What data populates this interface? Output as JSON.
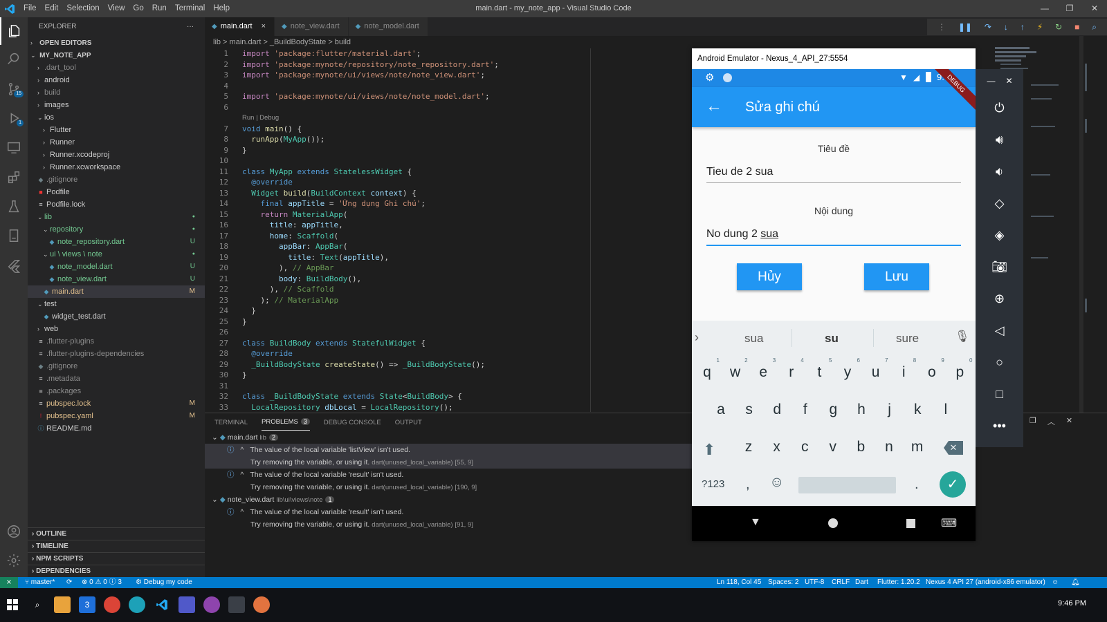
{
  "titlebar": {
    "menu": [
      "File",
      "Edit",
      "Selection",
      "View",
      "Go",
      "Run",
      "Terminal",
      "Help"
    ],
    "window_title": "main.dart - my_note_app - Visual Studio Code"
  },
  "activity": {
    "scm_badge": "15",
    "debug_badge": "1"
  },
  "sidebar": {
    "title": "EXPLORER",
    "more": "···",
    "open_editors": "OPEN EDITORS",
    "project": "MY_NOTE_APP",
    "tree": [
      {
        "label": ".dart_tool",
        "status": ""
      },
      {
        "label": "android",
        "status": ""
      },
      {
        "label": "build",
        "status": ""
      },
      {
        "label": "images",
        "status": ""
      },
      {
        "label": "ios",
        "status": ""
      },
      {
        "label": "Flutter",
        "status": ""
      },
      {
        "label": "Runner",
        "status": ""
      },
      {
        "label": "Runner.xcodeproj",
        "status": ""
      },
      {
        "label": "Runner.xcworkspace",
        "status": ""
      },
      {
        "label": ".gitignore",
        "status": ""
      },
      {
        "label": "Podfile",
        "status": ""
      },
      {
        "label": "Podfile.lock",
        "status": ""
      },
      {
        "label": "lib",
        "status": "●"
      },
      {
        "label": "repository",
        "status": "●"
      },
      {
        "label": "note_repository.dart",
        "status": "U"
      },
      {
        "label": "ui \\ views \\ note",
        "status": "●"
      },
      {
        "label": "note_model.dart",
        "status": "U"
      },
      {
        "label": "note_view.dart",
        "status": "U"
      },
      {
        "label": "main.dart",
        "status": "M"
      },
      {
        "label": "test",
        "status": ""
      },
      {
        "label": "widget_test.dart",
        "status": ""
      },
      {
        "label": "web",
        "status": ""
      },
      {
        "label": ".flutter-plugins",
        "status": ""
      },
      {
        "label": ".flutter-plugins-dependencies",
        "status": ""
      },
      {
        "label": ".gitignore",
        "status": ""
      },
      {
        "label": ".metadata",
        "status": ""
      },
      {
        "label": ".packages",
        "status": ""
      },
      {
        "label": "pubspec.lock",
        "status": "M"
      },
      {
        "label": "pubspec.yaml",
        "status": "M"
      },
      {
        "label": "README.md",
        "status": ""
      }
    ],
    "sections": [
      "OUTLINE",
      "TIMELINE",
      "NPM SCRIPTS",
      "DEPENDENCIES"
    ]
  },
  "tabs": [
    {
      "label": "main.dart",
      "close": "×"
    },
    {
      "label": "note_view.dart"
    },
    {
      "label": "note_model.dart"
    }
  ],
  "breadcrumb": "lib  >  main.dart  >  _BuildBodyState  >  build",
  "code": {
    "codelens": "Run | Debug",
    "lines": [
      {
        "n": "1",
        "html": "<span class=\"kw2\">import</span> <span class=\"st2\">'package:flutter/material.dart'</span>;"
      },
      {
        "n": "2",
        "html": "<span class=\"kw2\">import</span> <span class=\"st2\">'package:mynote/repository/note_repository.dart'</span>;"
      },
      {
        "n": "3",
        "html": "<span class=\"kw2\">import</span> <span class=\"st2\">'package:mynote/ui/views/note/note_view.dart'</span>;"
      },
      {
        "n": "4",
        "html": ""
      },
      {
        "n": "5",
        "html": "<span class=\"kw2\">import</span> <span class=\"st2\">'package:mynote/ui/views/note/note_model.dart'</span>;"
      },
      {
        "n": "6",
        "html": ""
      },
      {
        "n": "7",
        "html": "<span class=\"kw\">void</span> <span class=\"fn\">main</span>() {"
      },
      {
        "n": "8",
        "html": "  <span class=\"fn\">runApp</span>(<span class=\"ty\">MyApp</span>());"
      },
      {
        "n": "9",
        "html": "}"
      },
      {
        "n": "10",
        "html": ""
      },
      {
        "n": "11",
        "html": "<span class=\"kw\">class</span> <span class=\"ty\">MyApp</span> <span class=\"kw\">extends</span> <span class=\"ty\">StatelessWidget</span> {"
      },
      {
        "n": "12",
        "html": "  <span class=\"kw\">@override</span>"
      },
      {
        "n": "13",
        "html": "  <span class=\"ty\">Widget</span> <span class=\"fn\">build</span>(<span class=\"ty\">BuildContext</span> <span class=\"pr\">context</span>) {"
      },
      {
        "n": "14",
        "html": "    <span class=\"kw\">final</span> <span class=\"pr\">appTitle</span> = <span class=\"st2\">'Ứng dụng Ghi chú'</span>;"
      },
      {
        "n": "15",
        "html": "    <span class=\"kw2\">return</span> <span class=\"ty\">MaterialApp</span>("
      },
      {
        "n": "16",
        "html": "      <span class=\"pr\">title</span>: <span class=\"pr\">appTitle</span>,"
      },
      {
        "n": "17",
        "html": "      <span class=\"pr\">home</span>: <span class=\"ty\">Scaffold</span>("
      },
      {
        "n": "18",
        "html": "        <span class=\"pr\">appBar</span>: <span class=\"ty\">AppBar</span>("
      },
      {
        "n": "19",
        "html": "          <span class=\"pr\">title</span>: <span class=\"ty\">Text</span>(<span class=\"pr\">appTitle</span>),"
      },
      {
        "n": "20",
        "html": "        ), <span class=\"cm\">// AppBar</span>"
      },
      {
        "n": "21",
        "html": "        <span class=\"pr\">body</span>: <span class=\"ty\">BuildBody</span>(),"
      },
      {
        "n": "22",
        "html": "      ), <span class=\"cm\">// Scaffold</span>"
      },
      {
        "n": "23",
        "html": "    ); <span class=\"cm\">// MaterialApp</span>"
      },
      {
        "n": "24",
        "html": "  }"
      },
      {
        "n": "25",
        "html": "}"
      },
      {
        "n": "26",
        "html": ""
      },
      {
        "n": "27",
        "html": "<span class=\"kw\">class</span> <span class=\"ty\">BuildBody</span> <span class=\"kw\">extends</span> <span class=\"ty\">StatefulWidget</span> {"
      },
      {
        "n": "28",
        "html": "  <span class=\"kw\">@override</span>"
      },
      {
        "n": "29",
        "html": "  <span class=\"ty\">_BuildBodyState</span> <span class=\"fn\">createState</span>() =&gt; <span class=\"ty\">_BuildBodyState</span>();"
      },
      {
        "n": "30",
        "html": "}"
      },
      {
        "n": "31",
        "html": ""
      },
      {
        "n": "32",
        "html": "<span class=\"kw\">class</span> <span class=\"ty\">_BuildBodyState</span> <span class=\"kw\">extends</span> <span class=\"ty\">State</span>&lt;<span class=\"ty\">BuildBody</span>&gt; {"
      },
      {
        "n": "33",
        "html": "  <span class=\"ty\">LocalRepository</span> <span class=\"pr\">dbLocal</span> = <span class=\"ty\">LocalRepository</span>();"
      }
    ]
  },
  "panel": {
    "tabs": [
      "TERMINAL",
      "PROBLEMS",
      "DEBUG CONSOLE",
      "OUTPUT"
    ],
    "problems_count": "3",
    "groups": [
      {
        "file": "main.dart",
        "path": "lib",
        "count": "2",
        "items": [
          {
            "msg": "The value of the local variable 'listView' isn't used.",
            "hint": "Try removing the variable, or using it.",
            "src": "dart(unused_local_variable)",
            "pos": "[55, 9]"
          },
          {
            "msg": "The value of the local variable 'result' isn't used.",
            "hint": "Try removing the variable, or using it.",
            "src": "dart(unused_local_variable)",
            "pos": "[190, 9]"
          }
        ]
      },
      {
        "file": "note_view.dart",
        "path": "lib\\ui\\views\\note",
        "count": "1",
        "items": [
          {
            "msg": "The value of the local variable 'result' isn't used.",
            "hint": "Try removing the variable, or using it.",
            "src": "dart(unused_local_variable)",
            "pos": "[91, 9]"
          }
        ]
      }
    ]
  },
  "statusbar": {
    "branch": "master*",
    "problems": "⊗ 0 ⚠ 0 ⓘ 3",
    "debug": "Debug my code",
    "position": "Ln 118, Col 45",
    "spaces": "Spaces: 2",
    "encoding": "UTF-8",
    "eol": "CRLF",
    "language": "Dart",
    "flutter": "Flutter: 1.20.2",
    "device": "Nexus 4 API 27 (android-x86 emulator)"
  },
  "taskbar": {
    "time": "9:46 PM"
  },
  "emulator": {
    "title": "Android Emulator - Nexus_4_API_27:5554",
    "clock": "9:46",
    "debug_banner": "DEBUG",
    "app_title": "Sửa ghi chú",
    "field1_label": "Tiêu đề",
    "field1_value": "Tieu de 2 sua",
    "field2_label": "Nội dung",
    "field2_value_prefix": "No dung 2 ",
    "field2_value_word": "sua",
    "cancel": "Hủy",
    "save": "Lưu",
    "suggestions": [
      "sua",
      "su",
      "sure"
    ],
    "row1": [
      "q",
      "w",
      "e",
      "r",
      "t",
      "y",
      "u",
      "i",
      "o",
      "p"
    ],
    "row1_nums": [
      "1",
      "2",
      "3",
      "4",
      "5",
      "6",
      "7",
      "8",
      "9",
      "0"
    ],
    "row2": [
      "a",
      "s",
      "d",
      "f",
      "g",
      "h",
      "j",
      "k",
      "l"
    ],
    "row3": [
      "z",
      "x",
      "c",
      "v",
      "b",
      "n",
      "m"
    ],
    "symbols": "?123",
    "comma": ",",
    "period": "."
  },
  "colors": {
    "accent": "#007acc",
    "app_blue": "#2196f3",
    "statusbar_remote": "#16825d"
  }
}
